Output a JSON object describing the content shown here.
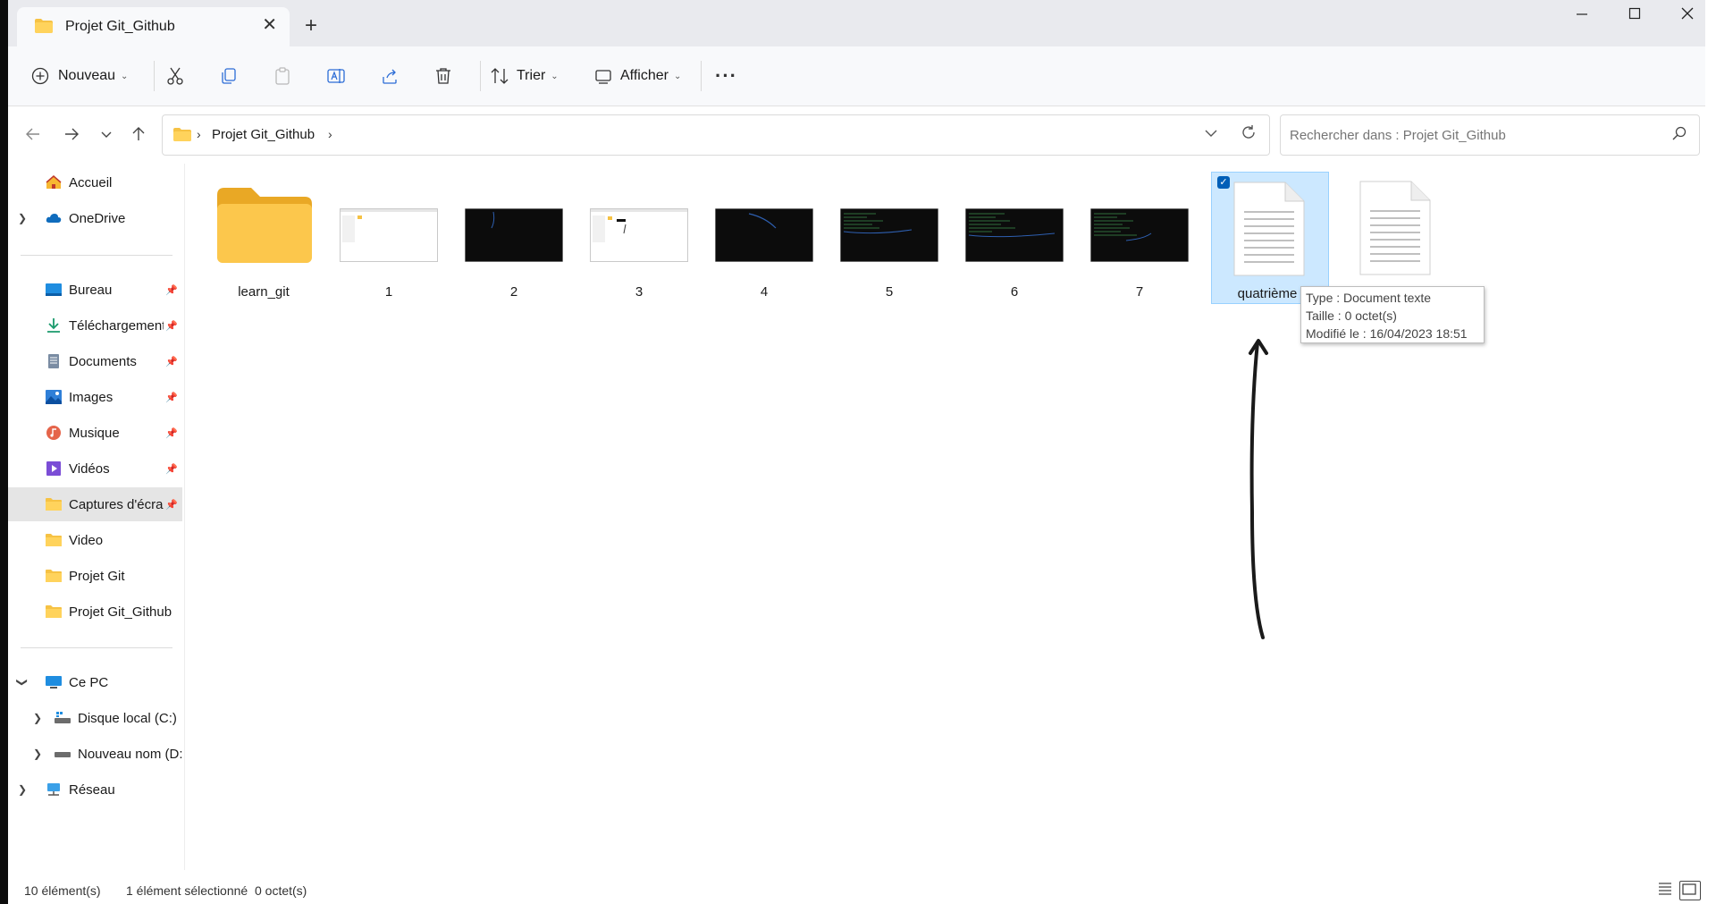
{
  "tab": {
    "title": "Projet Git_Github",
    "close": "✕",
    "new": "+"
  },
  "toolbar": {
    "new_label": "Nouveau",
    "sort_label": "Trier",
    "view_label": "Afficher",
    "more": "···"
  },
  "address": {
    "crumb": "Projet Git_Github"
  },
  "search": {
    "placeholder": "Rechercher dans : Projet Git_Github"
  },
  "sidebar": {
    "items": [
      {
        "label": "Accueil",
        "icon": "home-icon"
      },
      {
        "label": "OneDrive",
        "icon": "cloud-icon"
      },
      {
        "label": "Bureau",
        "icon": "desktop-icon"
      },
      {
        "label": "Téléchargements",
        "icon": "download-icon"
      },
      {
        "label": "Documents",
        "icon": "document-icon"
      },
      {
        "label": "Images",
        "icon": "image-icon"
      },
      {
        "label": "Musique",
        "icon": "music-icon"
      },
      {
        "label": "Vidéos",
        "icon": "video-icon"
      },
      {
        "label": "Captures d'écran",
        "icon": "folder-icon"
      },
      {
        "label": "Video",
        "icon": "folder-icon"
      },
      {
        "label": "Projet Git",
        "icon": "folder-icon"
      },
      {
        "label": "Projet Git_Github",
        "icon": "folder-icon"
      },
      {
        "label": "Ce PC",
        "icon": "pc-icon"
      },
      {
        "label": "Disque local (C:)",
        "icon": "drive-icon"
      },
      {
        "label": "Nouveau nom (D:)",
        "icon": "drive-icon"
      },
      {
        "label": "Réseau",
        "icon": "network-icon"
      }
    ]
  },
  "files": [
    {
      "name": "learn_git",
      "kind": "folder"
    },
    {
      "name": "1",
      "kind": "screenshot-light"
    },
    {
      "name": "2",
      "kind": "screenshot-dark"
    },
    {
      "name": "3",
      "kind": "screenshot-light"
    },
    {
      "name": "4",
      "kind": "screenshot-dark"
    },
    {
      "name": "5",
      "kind": "screenshot-dark"
    },
    {
      "name": "6",
      "kind": "screenshot-dark"
    },
    {
      "name": "7",
      "kind": "screenshot-dark"
    },
    {
      "name": "quatrième",
      "kind": "text-document",
      "selected": true
    },
    {
      "name": "",
      "kind": "text-document"
    }
  ],
  "tooltip": {
    "type": "Type : Document texte",
    "size": "Taille : 0 octet(s)",
    "modified": "Modifié le : 16/04/2023 18:51"
  },
  "status": {
    "count": "10 élément(s)",
    "selection": "1 élément sélectionné  0 octet(s)"
  },
  "colors": {
    "accent": "#005fb8",
    "folder": "#f6c244",
    "selection": "#cce8ff"
  }
}
